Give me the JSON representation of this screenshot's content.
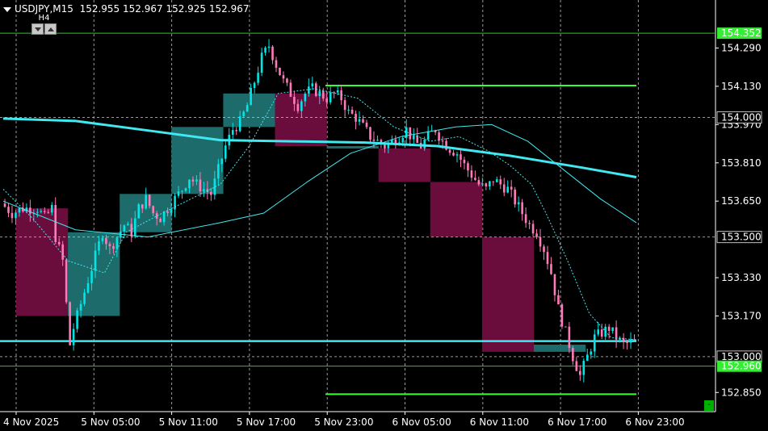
{
  "header": {
    "symbol": "USDJPY,M15",
    "ohlc": "152.955 152.967 152.925 152.967"
  },
  "timeframe_overlay": {
    "label": "H4"
  },
  "minus_button_label": "-",
  "colors": {
    "background": "#000000",
    "bull_candle": "#00e5e5",
    "bear_candle": "#ff7ab8",
    "bull_box": "#1e6b6b",
    "bear_box": "#6a0c3c",
    "ma_line": "#40e8f0",
    "hline_green": "#33ff33",
    "grid": "#c0c0c0"
  },
  "chart_data": {
    "type": "candlestick",
    "symbol": "USDJPY",
    "timeframe": "M15",
    "ylim": [
      152.77,
      154.43
    ],
    "x_ticks": [
      "4 Nov 2025",
      "5 Nov 05:00",
      "5 Nov 11:00",
      "5 Nov 17:00",
      "5 Nov 23:00",
      "6 Nov 05:00",
      "6 Nov 11:00",
      "6 Nov 17:00",
      "6 Nov 23:00"
    ],
    "y_ticks": [
      "154.290",
      "154.130",
      "153.970",
      "153.810",
      "153.650",
      "153.330",
      "153.170",
      "152.850"
    ],
    "price_markers": [
      {
        "value": 154.352,
        "label": "154.352",
        "style": "green"
      },
      {
        "value": 154.0,
        "label": "154.000",
        "style": "grid"
      },
      {
        "value": 153.5,
        "label": "153.500",
        "style": "grid"
      },
      {
        "value": 153.0,
        "label": "153.000",
        "style": "grid"
      },
      {
        "value": 152.96,
        "label": "152.960",
        "style": "green"
      }
    ],
    "horizontal_lines": [
      {
        "value": 154.352,
        "style": "green-thin"
      },
      {
        "value": 154.133,
        "style": "green-segment",
        "x_from": 403,
        "x_to": 788
      },
      {
        "value": 152.843,
        "style": "green-segment",
        "x_from": 403,
        "x_to": 788
      },
      {
        "value": 153.065,
        "style": "cyan-thick"
      },
      {
        "value": 152.96,
        "style": "green-thin"
      }
    ],
    "h4_boxes": [
      {
        "open": 153.62,
        "close": 153.17,
        "high": 153.7,
        "low": 152.98,
        "dir": "bear"
      },
      {
        "open": 153.17,
        "close": 153.52,
        "high": 153.6,
        "low": 153.1,
        "dir": "bull"
      },
      {
        "open": 153.52,
        "close": 153.68,
        "high": 153.75,
        "low": 153.48,
        "dir": "bull"
      },
      {
        "open": 153.68,
        "close": 153.96,
        "high": 154.02,
        "low": 153.6,
        "dir": "bull"
      },
      {
        "open": 153.96,
        "close": 154.1,
        "high": 154.36,
        "low": 153.92,
        "dir": "bull"
      },
      {
        "open": 154.1,
        "close": 153.88,
        "high": 154.14,
        "low": 153.84,
        "dir": "bear"
      },
      {
        "open": 153.88,
        "close": 153.87,
        "high": 154.0,
        "low": 153.8,
        "dir": "bull"
      },
      {
        "open": 153.87,
        "close": 153.73,
        "high": 153.96,
        "low": 153.55,
        "dir": "bear"
      },
      {
        "open": 153.73,
        "close": 153.5,
        "high": 153.8,
        "low": 153.42,
        "dir": "bear"
      },
      {
        "open": 153.5,
        "close": 153.02,
        "high": 153.55,
        "low": 152.85,
        "dir": "bear"
      },
      {
        "open": 153.02,
        "close": 153.05,
        "high": 153.14,
        "low": 152.95,
        "dir": "bull"
      }
    ],
    "price_path": [
      [
        0,
        153.64
      ],
      [
        3,
        153.6
      ],
      [
        6,
        153.62
      ],
      [
        10,
        153.62
      ],
      [
        12,
        153.58
      ],
      [
        14,
        153.62
      ],
      [
        15,
        153.5
      ],
      [
        17,
        153.4
      ],
      [
        18,
        153.22
      ],
      [
        19,
        153.05
      ],
      [
        20,
        153.12
      ],
      [
        22,
        153.22
      ],
      [
        24,
        153.32
      ],
      [
        26,
        153.42
      ],
      [
        28,
        153.52
      ],
      [
        30,
        153.45
      ],
      [
        32,
        153.5
      ],
      [
        34,
        153.55
      ],
      [
        36,
        153.52
      ],
      [
        38,
        153.62
      ],
      [
        40,
        153.66
      ],
      [
        42,
        153.6
      ],
      [
        44,
        153.58
      ],
      [
        46,
        153.62
      ],
      [
        48,
        153.66
      ],
      [
        50,
        153.7
      ],
      [
        52,
        153.75
      ],
      [
        54,
        153.72
      ],
      [
        56,
        153.7
      ],
      [
        58,
        153.68
      ],
      [
        60,
        153.78
      ],
      [
        62,
        153.88
      ],
      [
        64,
        153.95
      ],
      [
        66,
        153.98
      ],
      [
        68,
        154.05
      ],
      [
        70,
        154.15
      ],
      [
        72,
        154.25
      ],
      [
        74,
        154.3
      ],
      [
        76,
        154.22
      ],
      [
        78,
        154.15
      ],
      [
        80,
        154.1
      ],
      [
        82,
        154.05
      ],
      [
        84,
        154.1
      ],
      [
        86,
        154.12
      ],
      [
        88,
        154.1
      ],
      [
        90,
        154.08
      ],
      [
        92,
        154.1
      ],
      [
        94,
        154.08
      ],
      [
        96,
        154.02
      ],
      [
        98,
        154.0
      ],
      [
        100,
        153.96
      ],
      [
        102,
        153.92
      ],
      [
        104,
        153.9
      ],
      [
        106,
        153.88
      ],
      [
        108,
        153.9
      ],
      [
        110,
        153.92
      ],
      [
        112,
        153.95
      ],
      [
        114,
        153.9
      ],
      [
        116,
        153.88
      ],
      [
        118,
        153.92
      ],
      [
        120,
        153.95
      ],
      [
        122,
        153.9
      ],
      [
        124,
        153.87
      ],
      [
        126,
        153.85
      ],
      [
        128,
        153.8
      ],
      [
        130,
        153.76
      ],
      [
        132,
        153.72
      ],
      [
        134,
        153.7
      ],
      [
        136,
        153.74
      ],
      [
        138,
        153.72
      ],
      [
        140,
        153.7
      ],
      [
        142,
        153.65
      ],
      [
        144,
        153.6
      ],
      [
        146,
        153.55
      ],
      [
        148,
        153.52
      ],
      [
        150,
        153.45
      ],
      [
        152,
        153.35
      ],
      [
        154,
        153.2
      ],
      [
        156,
        153.1
      ],
      [
        158,
        153.0
      ],
      [
        160,
        152.92
      ],
      [
        162,
        153.0
      ],
      [
        164,
        153.08
      ],
      [
        166,
        153.1
      ],
      [
        168,
        153.12
      ],
      [
        170,
        153.08
      ],
      [
        172,
        153.05
      ],
      [
        174,
        153.06
      ]
    ],
    "moving_averages": [
      {
        "name": "MA-slow",
        "style": "thick",
        "points": [
          [
            0,
            153.995
          ],
          [
            20,
            153.985
          ],
          [
            40,
            153.945
          ],
          [
            60,
            153.905
          ],
          [
            80,
            153.9
          ],
          [
            100,
            153.895
          ],
          [
            120,
            153.88
          ],
          [
            140,
            153.84
          ],
          [
            160,
            153.79
          ],
          [
            175,
            153.75
          ]
        ]
      },
      {
        "name": "MA-mid",
        "style": "thin",
        "points": [
          [
            0,
            153.65
          ],
          [
            20,
            153.53
          ],
          [
            40,
            153.5
          ],
          [
            60,
            153.56
          ],
          [
            72,
            153.6
          ],
          [
            84,
            153.73
          ],
          [
            96,
            153.85
          ],
          [
            110,
            153.92
          ],
          [
            125,
            153.96
          ],
          [
            135,
            153.97
          ],
          [
            145,
            153.9
          ],
          [
            155,
            153.78
          ],
          [
            165,
            153.66
          ],
          [
            175,
            153.56
          ]
        ]
      },
      {
        "name": "MA-fast",
        "style": "dashed",
        "points": [
          [
            0,
            153.7
          ],
          [
            8,
            153.58
          ],
          [
            18,
            153.4
          ],
          [
            28,
            153.35
          ],
          [
            34,
            153.52
          ],
          [
            44,
            153.6
          ],
          [
            52,
            153.66
          ],
          [
            60,
            153.72
          ],
          [
            68,
            153.88
          ],
          [
            76,
            154.1
          ],
          [
            86,
            154.12
          ],
          [
            98,
            154.08
          ],
          [
            108,
            153.96
          ],
          [
            118,
            153.9
          ],
          [
            126,
            153.92
          ],
          [
            134,
            153.86
          ],
          [
            140,
            153.8
          ],
          [
            146,
            153.72
          ],
          [
            150,
            153.6
          ],
          [
            156,
            153.4
          ],
          [
            162,
            153.18
          ],
          [
            168,
            153.08
          ],
          [
            175,
            153.07
          ]
        ]
      }
    ],
    "n_bars": 175
  }
}
